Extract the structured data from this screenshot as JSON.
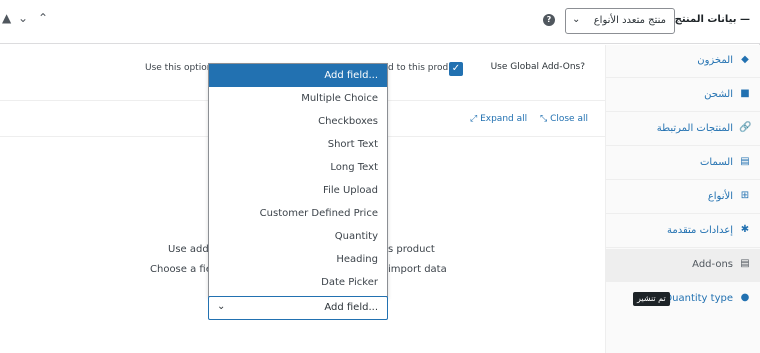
{
  "header": {
    "title": "بيانات المنتج —",
    "product_type": "منتج متعدد الأنواع",
    "help": "?",
    "up": "⌃",
    "down": "⌄",
    "collapse": "▲"
  },
  "sidebar": {
    "items": [
      {
        "label": "المخزون",
        "icon": "◆"
      },
      {
        "label": "الشحن",
        "icon": "■"
      },
      {
        "label": "المنتجات المرتبطة",
        "icon": "🔗"
      },
      {
        "label": "السمات",
        "icon": "▤"
      },
      {
        "label": "الأنواع",
        "icon": "⊞"
      },
      {
        "label": "إعدادات متقدمة",
        "icon": "✱"
      },
      {
        "label": "Add-ons",
        "icon": "▤"
      },
      {
        "label": "Quantity type",
        "icon": "●",
        "badge": "تم تنشير"
      }
    ]
  },
  "options": {
    "label": "Use Global Add-Ons?",
    "desc_right": "d to this prod",
    "desc_left": "Use this option."
  },
  "links": {
    "expand": "Expand all",
    "close": "Close all"
  },
  "empty": {
    "line1_left": "Use add-.",
    "line1_right": "s product",
    "line2_left": "Choose a fie.",
    "line2_right": "import data"
  },
  "dropdown": {
    "options": [
      "Add field...",
      "Multiple Choice",
      "Checkboxes",
      "Short Text",
      "Long Text",
      "File Upload",
      "Customer Defined Price",
      "Quantity",
      "Heading",
      "Date Picker"
    ],
    "selected": "Add field..."
  }
}
